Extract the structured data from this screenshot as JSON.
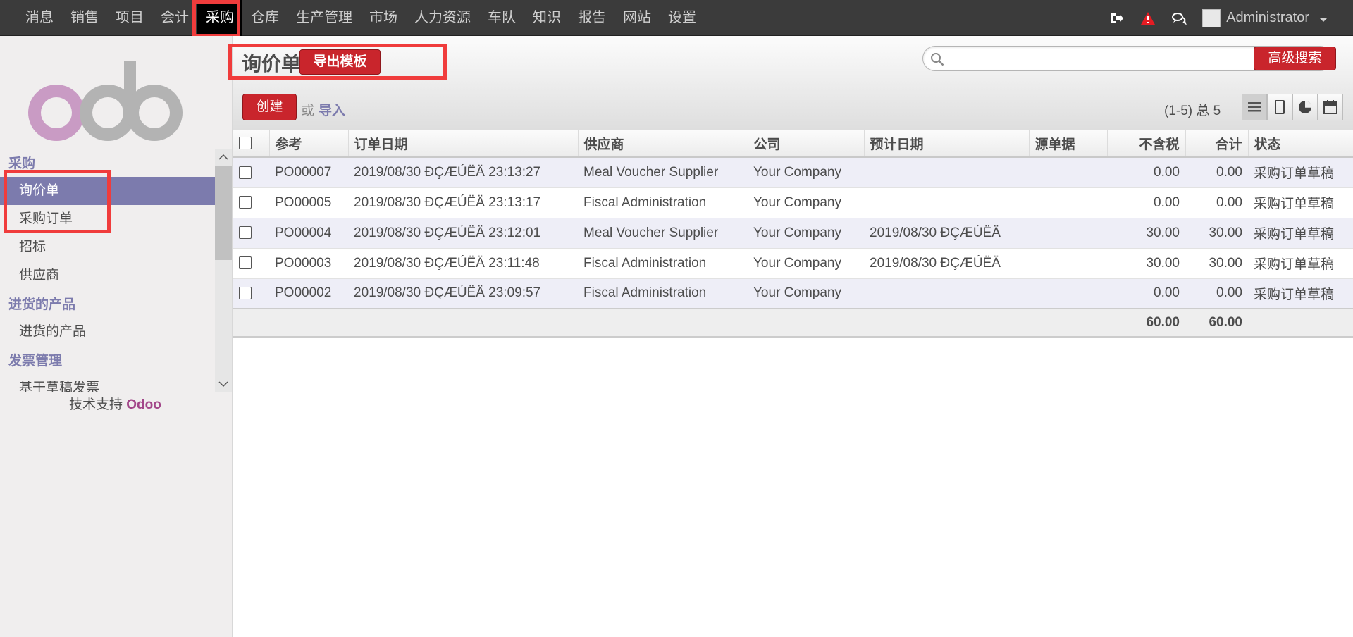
{
  "topbar": {
    "menu": [
      "消息",
      "销售",
      "项目",
      "会计",
      "采购",
      "仓库",
      "生产管理",
      "市场",
      "人力资源",
      "车队",
      "知识",
      "报告",
      "网站",
      "设置"
    ],
    "active_index": 4,
    "user": "Administrator"
  },
  "sidebar": {
    "logo_text": "odoo",
    "sections": [
      {
        "title": "采购",
        "items": [
          "询价单",
          "采购订单",
          "招标",
          "供应商"
        ]
      },
      {
        "title": "进货的产品",
        "items": [
          "进货的产品"
        ]
      },
      {
        "title": "发票管理",
        "items": [
          "基于草稿发票"
        ]
      }
    ],
    "active_item": "询价单",
    "support_prefix": "技术支持 ",
    "support_brand": "Odoo"
  },
  "header": {
    "title": "询价单",
    "export_label": "导出模板",
    "search_placeholder": "",
    "advanced_search_label": "高级搜索",
    "create_label": "创建",
    "or_label": "或",
    "import_label": "导入",
    "pager": "(1-5) 总 5"
  },
  "table": {
    "columns": [
      "参考",
      "订单日期",
      "供应商",
      "公司",
      "预计日期",
      "源单据",
      "不含税",
      "合计",
      "状态"
    ],
    "rows": [
      [
        "PO00007",
        "2019/08/30 ĐÇÆÚËÄ 23:13:27",
        "Meal Voucher Supplier",
        "Your Company",
        "",
        "",
        "0.00",
        "0.00",
        "采购订单草稿"
      ],
      [
        "PO00005",
        "2019/08/30 ĐÇÆÚËÄ 23:13:17",
        "Fiscal Administration",
        "Your Company",
        "",
        "",
        "0.00",
        "0.00",
        "采购订单草稿"
      ],
      [
        "PO00004",
        "2019/08/30 ĐÇÆÚËÄ 23:12:01",
        "Meal Voucher Supplier",
        "Your Company",
        "2019/08/30 ĐÇÆÚËÄ",
        "",
        "30.00",
        "30.00",
        "采购订单草稿"
      ],
      [
        "PO00003",
        "2019/08/30 ĐÇÆÚËÄ 23:11:48",
        "Fiscal Administration",
        "Your Company",
        "2019/08/30 ĐÇÆÚËÄ",
        "",
        "30.00",
        "30.00",
        "采购订单草稿"
      ],
      [
        "PO00002",
        "2019/08/30 ĐÇÆÚËÄ 23:09:57",
        "Fiscal Administration",
        "Your Company",
        "",
        "",
        "0.00",
        "0.00",
        "采购订单草稿"
      ]
    ],
    "totals": {
      "untaxed": "60.00",
      "total": "60.00"
    }
  },
  "colors": {
    "accent": "#7c7bad",
    "button_red": "#c9252c",
    "highlight": "#f03c3c"
  }
}
